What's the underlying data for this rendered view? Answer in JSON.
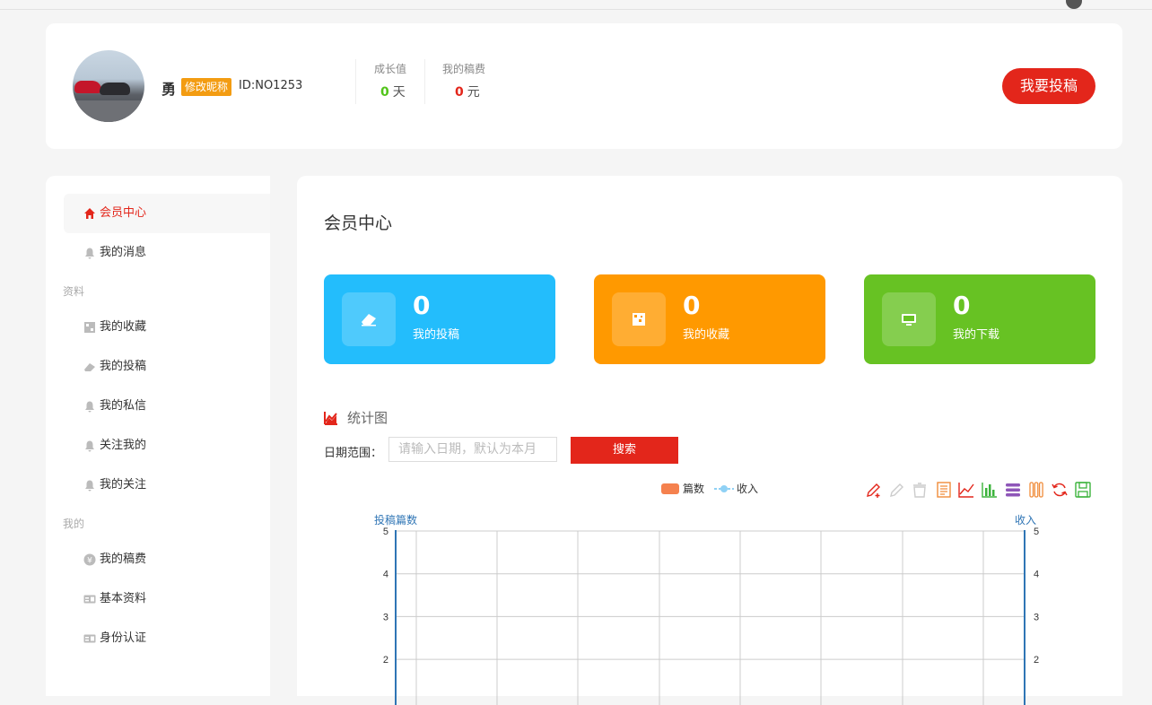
{
  "user": {
    "name": "勇",
    "edit_nickname": "修改昵称",
    "id": "ID:NO1253",
    "growth_label": "成长值",
    "growth_value": "0",
    "growth_unit": "天",
    "fee_label": "我的稿费",
    "fee_value": "0",
    "fee_unit": "元",
    "submit_button": "我要投稿"
  },
  "sidebar": {
    "items": [
      {
        "label": "会员中心",
        "icon": "home-icon",
        "active": true
      },
      {
        "label": "我的消息",
        "icon": "bell-icon"
      }
    ],
    "group_profile": "资料",
    "profile_items": [
      {
        "label": "我的收藏",
        "icon": "collection-icon"
      },
      {
        "label": "我的投稿",
        "icon": "eraser-icon"
      },
      {
        "label": "我的私信",
        "icon": "bell-icon"
      },
      {
        "label": "关注我的",
        "icon": "bell-icon"
      },
      {
        "label": "我的关注",
        "icon": "bell-icon"
      }
    ],
    "group_mine": "我的",
    "mine_items": [
      {
        "label": "我的稿费",
        "icon": "coin-icon"
      },
      {
        "label": "基本资料",
        "icon": "id-card-icon"
      },
      {
        "label": "身份认证",
        "icon": "id-card-icon"
      }
    ]
  },
  "main": {
    "title": "会员中心",
    "cards": [
      {
        "value": "0",
        "label": "我的投稿",
        "color": "#23bdfc",
        "icon": "eraser-icon"
      },
      {
        "value": "0",
        "label": "我的收藏",
        "color": "#ff9900",
        "icon": "collection-icon"
      },
      {
        "value": "0",
        "label": "我的下载",
        "color": "#67c223",
        "icon": "monitor-icon"
      }
    ],
    "stats_title": "统计图",
    "date_label": "日期范围：",
    "date_placeholder": "请输入日期，默认为本月",
    "search_button": "搜索"
  },
  "colors": {
    "accent": "#e3261b",
    "bar_series": "#f5814e",
    "line_series": "#8fd1f5"
  },
  "chart_data": {
    "type": "bar",
    "categories": [
      "",
      "",
      "",
      "",
      "",
      "",
      "",
      ""
    ],
    "series": [
      {
        "name": "篇数",
        "type": "bar",
        "values": []
      },
      {
        "name": "收入",
        "type": "line",
        "values": []
      }
    ],
    "ylabel": "投稿篇数",
    "ylabel_right": "收入",
    "ylim": [
      0,
      5
    ],
    "ylim_right": [
      0,
      5
    ],
    "yticks": [
      "2",
      "3",
      "4",
      "5"
    ],
    "grid": true,
    "legend": "top-center",
    "toolbox": [
      "pen-add-icon",
      "pen-icon",
      "eraser-icon",
      "data-view-icon",
      "line-chart-icon",
      "bar-chart-icon",
      "stack-icon",
      "tiled-icon",
      "refresh-icon",
      "save-icon"
    ]
  }
}
